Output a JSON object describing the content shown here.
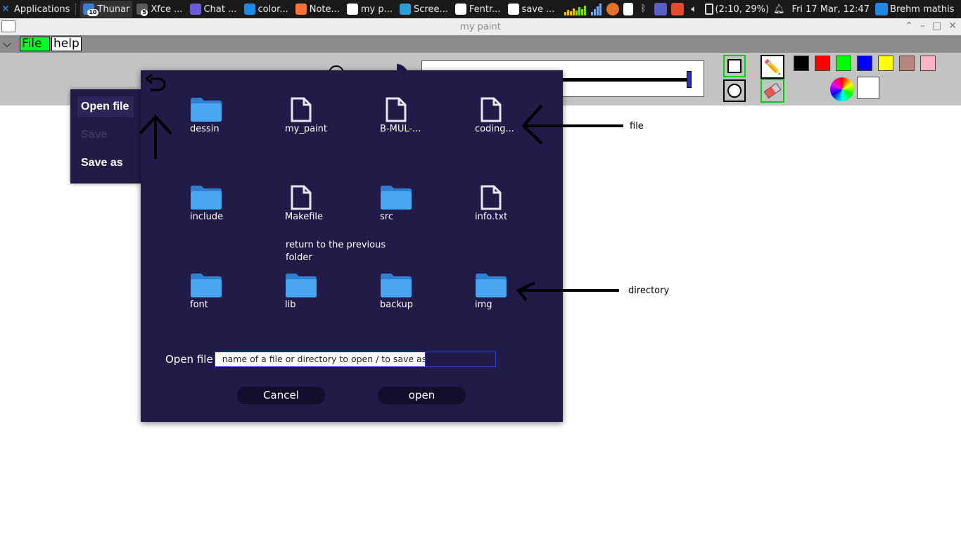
{
  "taskbar": {
    "apps_label": "Applications",
    "tasks": [
      {
        "label": "Thunar",
        "color": "#3a7bd5",
        "badge": "10"
      },
      {
        "label": "Xfce ...",
        "color": "#5a5a5a",
        "badge": "5"
      },
      {
        "label": "Chat ...",
        "color": "#6b5bd6"
      },
      {
        "label": "color...",
        "color": "#1e88e5"
      },
      {
        "label": "Note...",
        "color": "#ff7139"
      },
      {
        "label": "my p...",
        "color": "#ffffff"
      },
      {
        "label": "Scree...",
        "color": "#2a9fd6"
      },
      {
        "label": "Fentr...",
        "color": "#ffffff"
      },
      {
        "label": "save ...",
        "color": "#ffffff"
      }
    ],
    "battery": "(2:10, 29%)",
    "datetime": "Fri 17 Mar, 12:47",
    "user": "Brehm mathis"
  },
  "window": {
    "title": "my paint",
    "controls": [
      "⌃",
      "–",
      "□",
      "✕"
    ]
  },
  "menubar": {
    "file_label": "File",
    "help_label": "help"
  },
  "toolbar": {
    "brush_size_fraction": 0.99,
    "palette": [
      "#000000",
      "#ff0000",
      "#00ff00",
      "#0000ff",
      "#ffff00",
      "#b7877e",
      "#ffb3c6"
    ],
    "current_color": "#ffffff",
    "selection_color": "#00d000"
  },
  "file_menu": {
    "open_label": "Open file",
    "save_label": "Save",
    "save_as_label": "Save as"
  },
  "dialog": {
    "entries": [
      {
        "name": "dessin",
        "kind": "directory"
      },
      {
        "name": "my_paint",
        "kind": "file"
      },
      {
        "name": "B-MUL-...",
        "kind": "file"
      },
      {
        "name": "coding...",
        "kind": "file"
      },
      {
        "name": "include",
        "kind": "directory"
      },
      {
        "name": "Makefile",
        "kind": "file"
      },
      {
        "name": "src",
        "kind": "directory"
      },
      {
        "name": "info.txt",
        "kind": "file"
      },
      {
        "name": "font",
        "kind": "directory"
      },
      {
        "name": "lib",
        "kind": "directory"
      },
      {
        "name": "backup",
        "kind": "directory"
      },
      {
        "name": "img",
        "kind": "directory"
      }
    ],
    "path_label": "Open file",
    "path_placeholder": "name of a file or directory to open / to save as",
    "cancel_label": "Cancel",
    "open_label": "open",
    "background": "#211b47",
    "folder_color": "#4aa6f0",
    "file_icon_color": "#e6e6f5"
  },
  "annotations": {
    "file": "file",
    "directory": "directory",
    "back": "return to the previous folder"
  }
}
